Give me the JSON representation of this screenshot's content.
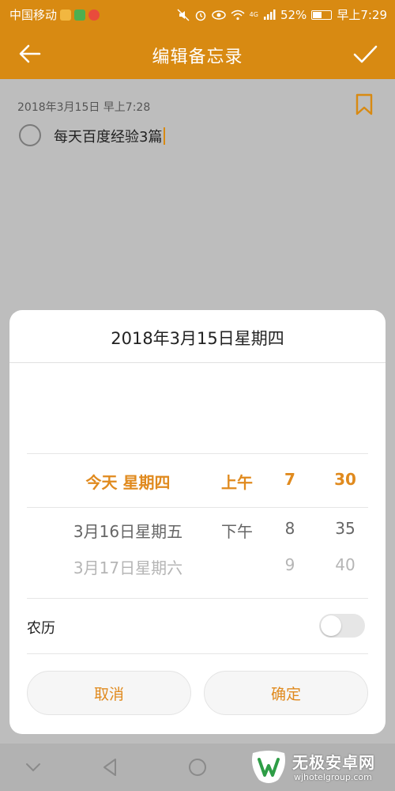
{
  "status_bar": {
    "carrier": "中国移动",
    "battery": "52%",
    "battery_level": 0.52,
    "network": "4G",
    "time": "早上7:29",
    "icons": [
      "mute-icon",
      "alarm-icon",
      "eye-icon",
      "wifi-icon",
      "signal-icon",
      "battery-icon"
    ]
  },
  "toolbar": {
    "title": "编辑备忘录",
    "back_icon": "arrow-left-icon",
    "confirm_icon": "check-icon",
    "background": "#d88a12"
  },
  "note": {
    "timestamp": "2018年3月15日 早上7:28",
    "text": "每天百度经验3篇",
    "bookmark_icon": "bookmark-icon"
  },
  "dialog": {
    "title": "2018年3月15日星期四",
    "picker": {
      "day": {
        "selected": "今天 星期四",
        "next1": "3月16日星期五",
        "next2": "3月17日星期六"
      },
      "ampm": {
        "selected": "上午",
        "next1": "下午"
      },
      "hour": {
        "selected": "7",
        "next1": "8",
        "next2": "9"
      },
      "minute": {
        "selected": "30",
        "next1": "35",
        "next2": "40"
      }
    },
    "lunar_label": "农历",
    "lunar_enabled": false,
    "cancel_label": "取消",
    "ok_label": "确定",
    "accent_color": "#e08a1e"
  },
  "nav_bar": {
    "icons": [
      "chevron-down-icon",
      "back-triangle-icon",
      "home-circle-icon"
    ]
  },
  "watermark": {
    "name_cn": "无极安卓网",
    "url": "wjhotelgroup.com"
  }
}
